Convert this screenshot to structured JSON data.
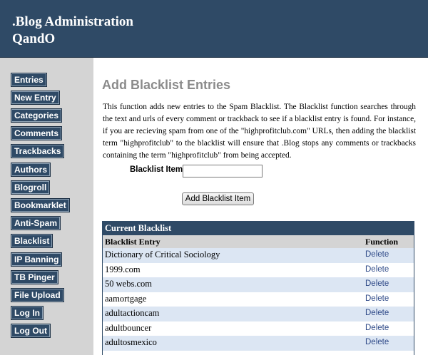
{
  "header": {
    "title_line1": ".Blog Administration",
    "title_line2": "QandO"
  },
  "sidebar": {
    "items": [
      {
        "label": "Entries"
      },
      {
        "label": "New Entry"
      },
      {
        "label": "Categories"
      },
      {
        "label": "Comments"
      },
      {
        "label": "Trackbacks"
      },
      {
        "label": "Authors"
      },
      {
        "label": "Blogroll"
      },
      {
        "label": "Bookmarklet"
      },
      {
        "label": "Anti-Spam"
      },
      {
        "label": "Blacklist"
      },
      {
        "label": "IP Banning"
      },
      {
        "label": "TB Pinger"
      },
      {
        "label": "File Upload"
      },
      {
        "label": "Log In"
      },
      {
        "label": "Log Out"
      }
    ]
  },
  "main": {
    "heading": "Add Blacklist Entries",
    "intro": "This function adds new entries to the Spam Blacklist. The Blacklist function searches through the text and urls of every comment or trackback to see if a blacklist entry is found. For instance, if you are recieving spam from one of the \"highprofitclub.com\" URLs, then adding the blacklist term \"highprofitclub\" to the blacklist will ensure that .Blog stops any comments or trackbacks containing the term \"highprofitclub\" from being accepted.",
    "item_label": "Blacklist Item:",
    "item_value": "",
    "add_button": "Add Blacklist Item"
  },
  "blacklist": {
    "title": "Current Blacklist",
    "col_entry": "Blacklist Entry",
    "col_function": "Function",
    "rows": [
      {
        "entry": "Dictionary of Critical Sociology",
        "action": "Delete"
      },
      {
        "entry": "1999.com",
        "action": "Delete"
      },
      {
        "entry": "50 webs.com",
        "action": "Delete"
      },
      {
        "entry": "aamortgage",
        "action": "Delete"
      },
      {
        "entry": "adultactioncam",
        "action": "Delete"
      },
      {
        "entry": "adultbouncer",
        "action": "Delete"
      },
      {
        "entry": "adultosmexico",
        "action": "Delete"
      }
    ]
  }
}
